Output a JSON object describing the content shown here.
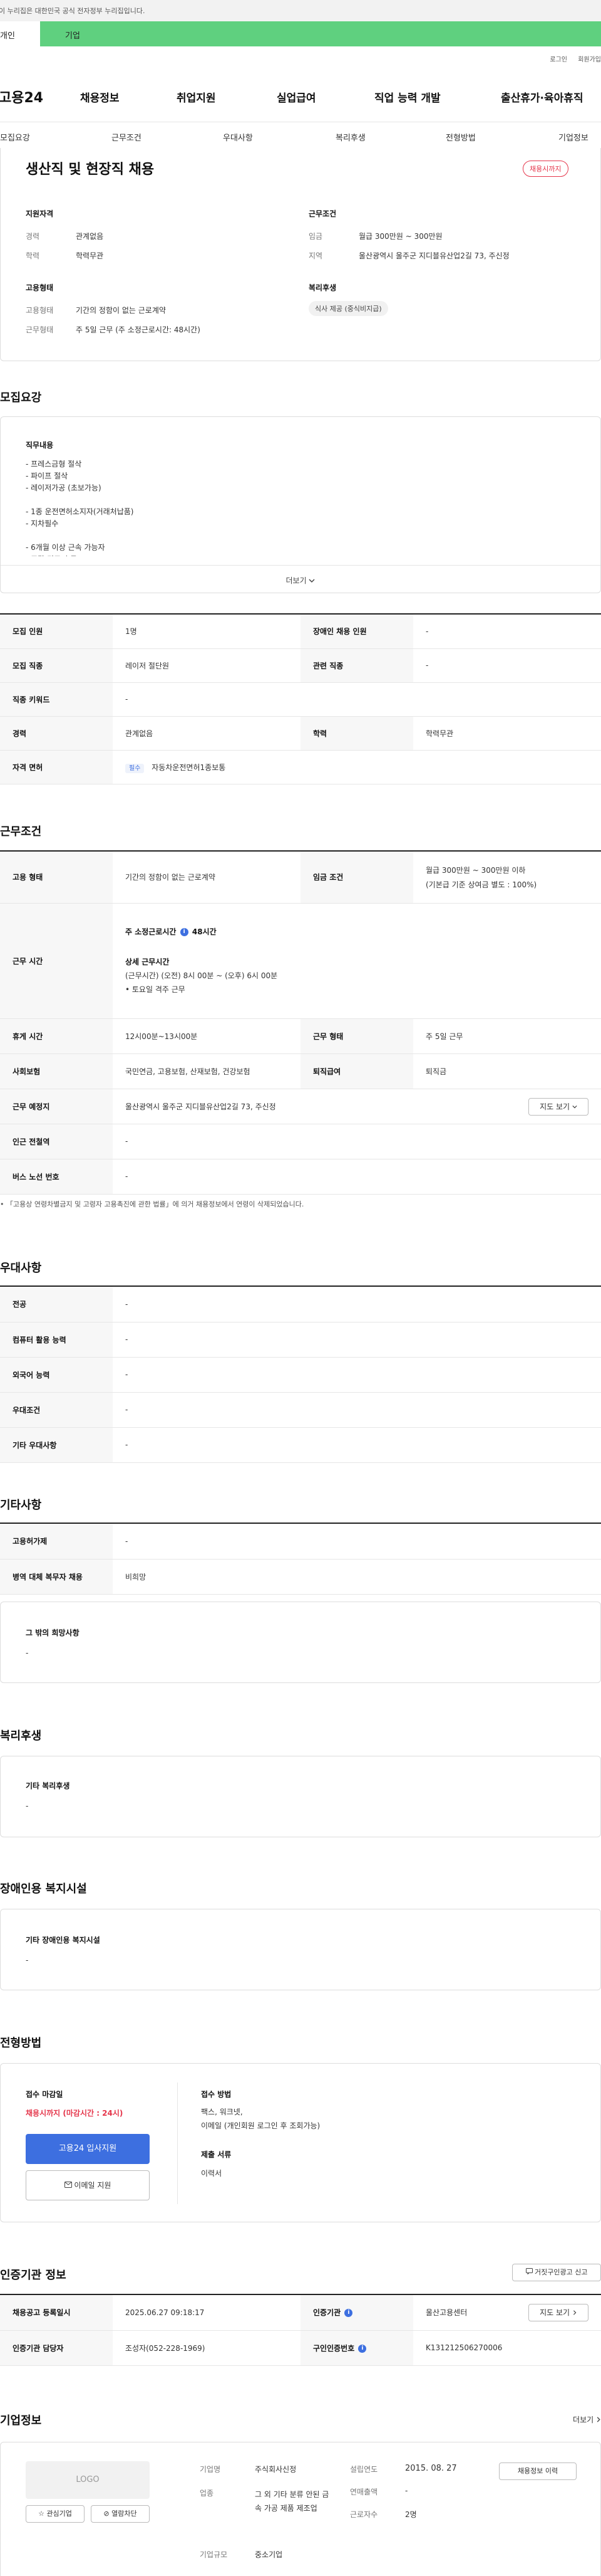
{
  "govbar": {
    "text": "이 누리집은 대한민국 공식 전자정부 누리집입니다."
  },
  "user_tabs": {
    "personal": "개인",
    "company": "기업"
  },
  "util": {
    "login": "로그인",
    "signup": "회원가입"
  },
  "logo": "고용24",
  "gnb": [
    "채용정보",
    "취업지원",
    "실업급여",
    "직업 능력 개발",
    "출산휴가·육아휴직"
  ],
  "anchor_tabs": [
    "모집요강",
    "근무조건",
    "우대사항",
    "복리후생",
    "전형방법",
    "기업정보"
  ],
  "summary": {
    "title": "생산직 및 현장직 채용",
    "status_badge": "채용시까지",
    "qual": {
      "heading": "지원자격",
      "rows": [
        {
          "label": "경력",
          "value": "관계없음"
        },
        {
          "label": "학력",
          "value": "학력무관"
        }
      ]
    },
    "cond": {
      "heading": "근무조건",
      "rows": [
        {
          "label": "임금",
          "value": "월급 300만원 ~ 300만원"
        },
        {
          "label": "지역",
          "value": "울산광역시 울주군 지디블유산업2길 73, 주신정"
        }
      ]
    },
    "emp": {
      "heading": "고용형태",
      "rows": [
        {
          "label": "고용형태",
          "value": "기간의 정함이 없는 근로계약"
        },
        {
          "label": "근무형태",
          "value": "주 5일 근무 (주 소정근로시간: 48시간)"
        }
      ]
    },
    "welfare": {
      "heading": "복리후생",
      "chip": "식사 제공 (중식비지급)"
    }
  },
  "recruit": {
    "heading": "모집요강",
    "duty_title": "직무내용",
    "duty_lines": [
      "- 프레스금형 절삭",
      "- 파이프 절삭",
      "- 레이저가공 (초보가능)",
      "",
      "- 1종 운전면허소지자(거래처납품)",
      "- 지차필수",
      "",
      "- 6개월 이상 근속 가능자",
      "- 주말 격주 휴무"
    ],
    "more": "더보기",
    "rows": [
      {
        "l1": "모집 인원",
        "v1": "1명",
        "l2": "장애인 채용 인원",
        "v2": "-"
      },
      {
        "l1": "모집 직종",
        "v1": "레이저 절단원",
        "l2": "관련 직종",
        "v2": "-"
      },
      {
        "l1": "직종 키워드",
        "v1": "-"
      },
      {
        "l1": "경력",
        "v1": "관계없음",
        "l2": "학력",
        "v2": "학력무관"
      },
      {
        "l1": "자격 면허",
        "v1_chip": "필수",
        "v1": "자동차운전면허1종보통"
      }
    ]
  },
  "work": {
    "heading": "근무조건",
    "emp_type_label": "고용 형태",
    "emp_type": "기간의 정함이 없는 근로계약",
    "wage_label": "임금 조건",
    "wage": "월급 300만원 ~ 300만원 이하",
    "wage_note": "(기본급 기준 상여금 별도 : 100%)",
    "hours_label": "근무 시간",
    "hours_main": "주 소정근로시간",
    "hours_value": "48시간",
    "hours_detail_title": "상세 근무시간",
    "hours_detail": "(근무시간) (오전) 8시 00분 ~ (오후) 6시 00분",
    "hours_extra": "• 토요일 격주 근무",
    "rest_label": "휴게 시간",
    "rest": "12시00분~13시00분",
    "form_label": "근무 형태",
    "form": "주 5일 근무",
    "ins_label": "사회보험",
    "ins": "국민연금, 고용보험, 산재보험, 건강보험",
    "ret_label": "퇴직급여",
    "ret": "퇴직금",
    "loc_label": "근무 예정지",
    "loc": "울산광역시 울주군 지디블유산업2길 73, 주신정",
    "map_btn": "지도 보기",
    "subway_label": "인근 전철역",
    "subway": "-",
    "bus_label": "버스 노선 번호",
    "bus": "-",
    "note": "「고용상 연령차별금지 및 고령자 고용촉진에 관한 법률」에 의거 채용정보에서 연령이 삭제되었습니다."
  },
  "pref": {
    "heading": "우대사항",
    "rows": [
      {
        "label": "전공",
        "value": "-"
      },
      {
        "label": "컴퓨터 활용 능력",
        "value": "-"
      },
      {
        "label": "외국어 능력",
        "value": "-"
      },
      {
        "label": "우대조건",
        "value": "-"
      },
      {
        "label": "기타 우대사항",
        "value": "-"
      }
    ]
  },
  "etc": {
    "heading": "기타사항",
    "rows": [
      {
        "label": "고용허가제",
        "value": "-"
      },
      {
        "label": "병역 대체 복무자 채용",
        "value": "비희망"
      }
    ],
    "box_title": "그 밖의 희망사항",
    "box_value": "-"
  },
  "benefit": {
    "heading": "복리후생",
    "box_title": "기타 복리후생",
    "box_value": "-"
  },
  "disab": {
    "heading": "장애인용 복지시설",
    "box_title": "기타 장애인용 복지시설",
    "box_value": "-"
  },
  "process": {
    "heading": "전형방법",
    "deadline_title": "접수 마감일",
    "deadline_value": "채용시까지 (마감시간 : 24시)",
    "apply_btn": "고용24 입사지원",
    "email_btn": "이메일 지원",
    "method_title": "접수 방법",
    "method_lines": [
      "팩스, 워크넷,",
      "이메일 (개인회원 로그인 후 조회가능)"
    ],
    "docs_title": "제출 서류",
    "docs_value": "이력서"
  },
  "agency": {
    "heading": "인증기관 정보",
    "report_btn": "거짓구인광고 신고",
    "reg_label": "채용공고 등록일시",
    "reg": "2025.06.27 09:18:17",
    "inst_label": "인증기관",
    "inst": "울산고용센터",
    "map_btn": "지도 보기",
    "mgr_label": "인증기관 담당자",
    "mgr": "조성자(052-228-1969)",
    "num_label": "구인인증번호",
    "num": "K131212506270006"
  },
  "company": {
    "heading": "기업정보",
    "more": "더보기",
    "logo": "LOGO",
    "fav_btn": "관심기업",
    "block_btn": "열람차단",
    "rows": [
      {
        "label": "기업명",
        "value": "주식회사신정"
      },
      {
        "label": "업종",
        "value": "그 외 기타 분류 안된 금속 가공 제품 제조업"
      },
      {
        "label": "기업규모",
        "value": "중소기업"
      }
    ],
    "est_label": "설립연도",
    "est": "2015. 08. 27",
    "sales_label": "연매출액",
    "sales": "-",
    "emp_label": "근로자수",
    "emp": "2명",
    "info_btn": "채용정보 이력"
  },
  "colors": {
    "accent": "#5fd07f",
    "red": "#e5374c",
    "blue": "#3d6fe0"
  }
}
